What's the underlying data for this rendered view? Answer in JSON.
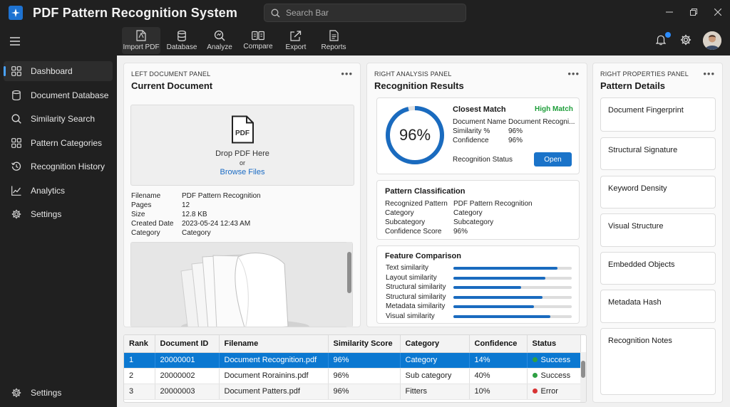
{
  "app": {
    "title": "PDF Pattern Recognition System"
  },
  "search": {
    "placeholder": "Search Bar"
  },
  "sidebar": {
    "items": [
      {
        "label": "Dashboard",
        "icon": "grid-icon"
      },
      {
        "label": "Document Database",
        "icon": "database-icon"
      },
      {
        "label": "Similarity Search",
        "icon": "search-icon"
      },
      {
        "label": "Pattern Categories",
        "icon": "grid-icon"
      },
      {
        "label": "Recognition History",
        "icon": "history-icon"
      },
      {
        "label": "Analytics",
        "icon": "chart-icon"
      },
      {
        "label": "Settings",
        "icon": "gear-icon"
      }
    ],
    "bottom_settings": "Settings"
  },
  "toolbar": {
    "buttons": [
      {
        "label": "Import PDF",
        "icon": "pdf-import-icon"
      },
      {
        "label": "Database",
        "icon": "database-icon"
      },
      {
        "label": "Analyze",
        "icon": "analyze-icon"
      },
      {
        "label": "Compare",
        "icon": "compare-icon"
      },
      {
        "label": "Export",
        "icon": "export-icon"
      },
      {
        "label": "Reports",
        "icon": "report-icon"
      }
    ]
  },
  "left_panel": {
    "label": "LEFT DOCUMENT PANEL",
    "title": "Current Document",
    "dropzone": {
      "icon_text": "PDF",
      "drop_text": "Drop PDF Here",
      "or_text": "or",
      "browse_text": "Browse Files"
    },
    "metadata": [
      {
        "key": "Filename",
        "value": "PDF Pattern Recognition"
      },
      {
        "key": "Pages",
        "value": "12"
      },
      {
        "key": "Size",
        "value": "12.8 KB"
      },
      {
        "key": "Created Date",
        "value": "2023-05-24 12:43 AM"
      },
      {
        "key": "Category",
        "value": "Category"
      }
    ]
  },
  "analysis_panel": {
    "label": "RIGHT ANALYSIS PANEL",
    "title": "Recognition Results",
    "gauge": {
      "value": 0.96,
      "text": "96%"
    },
    "closest_match": {
      "title": "Closest Match",
      "badge": "High Match",
      "badge_color": "#1e9e3a",
      "rows": [
        {
          "key": "Document Name",
          "value": "Document Recogni..."
        },
        {
          "key": "Similarity %",
          "value": "96%"
        },
        {
          "key": "Confidence",
          "value": "96%"
        }
      ],
      "status_label": "Recognition Status",
      "open_label": "Open"
    },
    "classification": {
      "title": "Pattern Classification",
      "rows": [
        {
          "key": "Recognized Pattern",
          "value": "PDF Pattern Recognition"
        },
        {
          "key": "Category",
          "value": "Category"
        },
        {
          "key": "Subcategory",
          "value": "Subcategory"
        },
        {
          "key": "Confidence Score",
          "value": "96%"
        }
      ]
    },
    "features": {
      "title": "Feature Comparison",
      "rows": [
        {
          "label": "Text similarity",
          "value": 0.88
        },
        {
          "label": "Layout similarity",
          "value": 0.78
        },
        {
          "label": "Structural similarity",
          "value": 0.57
        },
        {
          "label": "Structural similarity",
          "value": 0.75
        },
        {
          "label": "Metadata similarity",
          "value": 0.68
        },
        {
          "label": "Visual similarity",
          "value": 0.82
        }
      ]
    }
  },
  "properties_panel": {
    "label": "RIGHT PROPERTIES PANEL",
    "title": "Pattern Details",
    "items": [
      "Document Fingerprint",
      "Structural Signature",
      "Keyword Density",
      "Visual Structure",
      "Embedded Objects",
      "Metadata Hash",
      "Recognition Notes"
    ]
  },
  "results_table": {
    "columns": [
      "Rank",
      "Document ID",
      "Filename",
      "Similarity Score",
      "Category",
      "Confidence",
      "Status"
    ],
    "rows": [
      {
        "rank": "1",
        "id": "20000001",
        "filename": "Document Recognition.pdf",
        "score": "96%",
        "category": "Category",
        "confidence": "14%",
        "status": "Success",
        "status_color": "#2ea043"
      },
      {
        "rank": "2",
        "id": "20000002",
        "filename": "Document Rorainins.pdf",
        "score": "96%",
        "category": "Sub category",
        "confidence": "40%",
        "status": "Success",
        "status_color": "#2ea043"
      },
      {
        "rank": "3",
        "id": "20000003",
        "filename": "Document Patters.pdf",
        "score": "96%",
        "category": "Fitters",
        "confidence": "10%",
        "status": "Error",
        "status_color": "#d83434"
      }
    ]
  },
  "colors": {
    "accent": "#1a73c9",
    "gauge_blue": "#1a6bbf",
    "sidebar_bg": "#202020",
    "main_bg": "#f0f0f0"
  }
}
